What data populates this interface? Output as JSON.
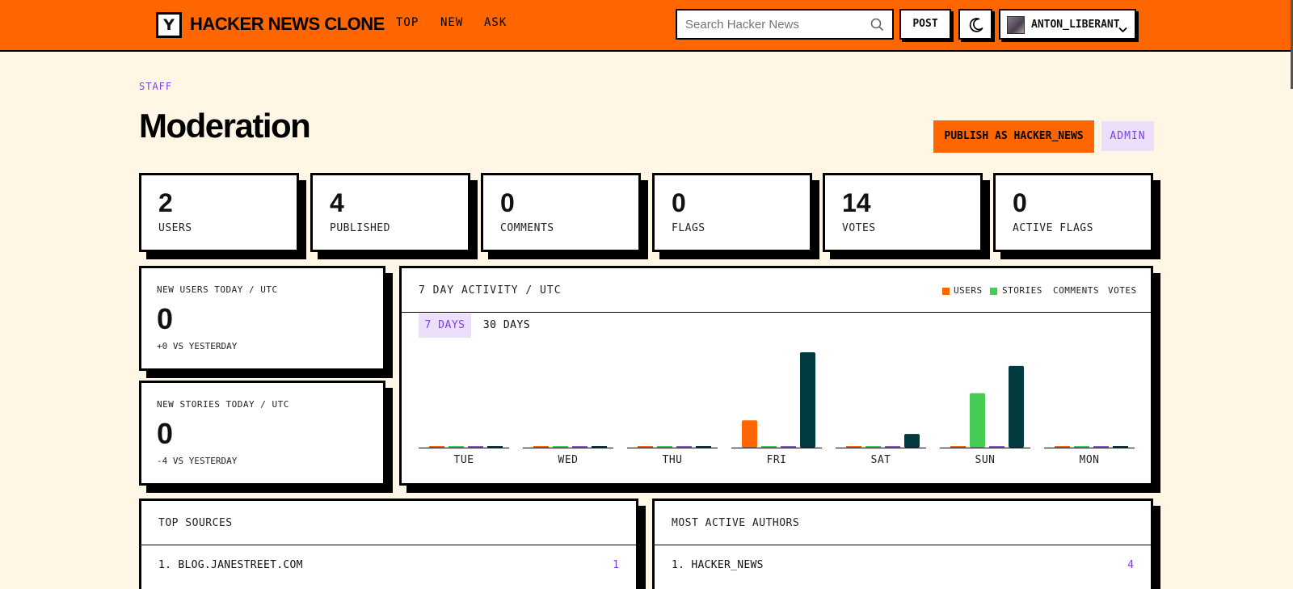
{
  "header": {
    "logo_letter": "Y",
    "brand": "HACKER NEWS CLONE",
    "nav": [
      "TOP",
      "NEW",
      "ASK"
    ],
    "search_placeholder": "Search Hacker News",
    "post_label": "POST",
    "username": "ANTON_LIBERANT"
  },
  "page": {
    "eyebrow": "STAFF",
    "title": "Moderation",
    "publish_label": "PUBLISH AS HACKER_NEWS",
    "admin_label": "ADMIN"
  },
  "stats": [
    {
      "value": "2",
      "label": "USERS"
    },
    {
      "value": "4",
      "label": "PUBLISHED"
    },
    {
      "value": "0",
      "label": "COMMENTS"
    },
    {
      "value": "0",
      "label": "FLAGS"
    },
    {
      "value": "14",
      "label": "VOTES"
    },
    {
      "value": "0",
      "label": "ACTIVE FLAGS"
    }
  ],
  "today": [
    {
      "title": "NEW USERS TODAY / UTC",
      "value": "0",
      "delta": "+0 VS YESTERDAY"
    },
    {
      "title": "NEW STORIES TODAY / UTC",
      "value": "0",
      "delta": "-4 VS YESTERDAY"
    }
  ],
  "activity": {
    "title": "7 DAY ACTIVITY / UTC",
    "legend": [
      "USERS",
      "STORIES",
      "COMMENTS",
      "VOTES"
    ],
    "tabs": [
      "7 DAYS",
      "30 DAYS"
    ],
    "active_tab": "7 DAYS"
  },
  "colors": {
    "accent": "#ff6600",
    "users": "#ff6600",
    "stories": "#44cc55",
    "comments": "#8a5ad8",
    "votes": "#023b3f",
    "purple": "#7b3fe4"
  },
  "chart_data": {
    "type": "bar",
    "categories": [
      "TUE",
      "WED",
      "THU",
      "FRI",
      "SAT",
      "SUN",
      "MON"
    ],
    "series": [
      {
        "name": "USERS",
        "values": [
          0,
          0,
          0,
          2,
          0,
          0,
          0
        ]
      },
      {
        "name": "STORIES",
        "values": [
          0,
          0,
          0,
          0,
          0,
          4,
          0
        ]
      },
      {
        "name": "COMMENTS",
        "values": [
          0,
          0,
          0,
          0,
          0,
          0,
          0
        ]
      },
      {
        "name": "VOTES",
        "values": [
          0,
          0,
          0,
          7,
          1,
          6,
          0
        ]
      }
    ],
    "ylim": [
      0,
      7
    ]
  },
  "top_sources": {
    "title": "TOP SOURCES",
    "items": [
      {
        "label": "1. BLOG.JANESTREET.COM",
        "count": "1"
      }
    ]
  },
  "active_authors": {
    "title": "MOST ACTIVE AUTHORS",
    "items": [
      {
        "label": "1. HACKER_NEWS",
        "count": "4"
      }
    ]
  }
}
